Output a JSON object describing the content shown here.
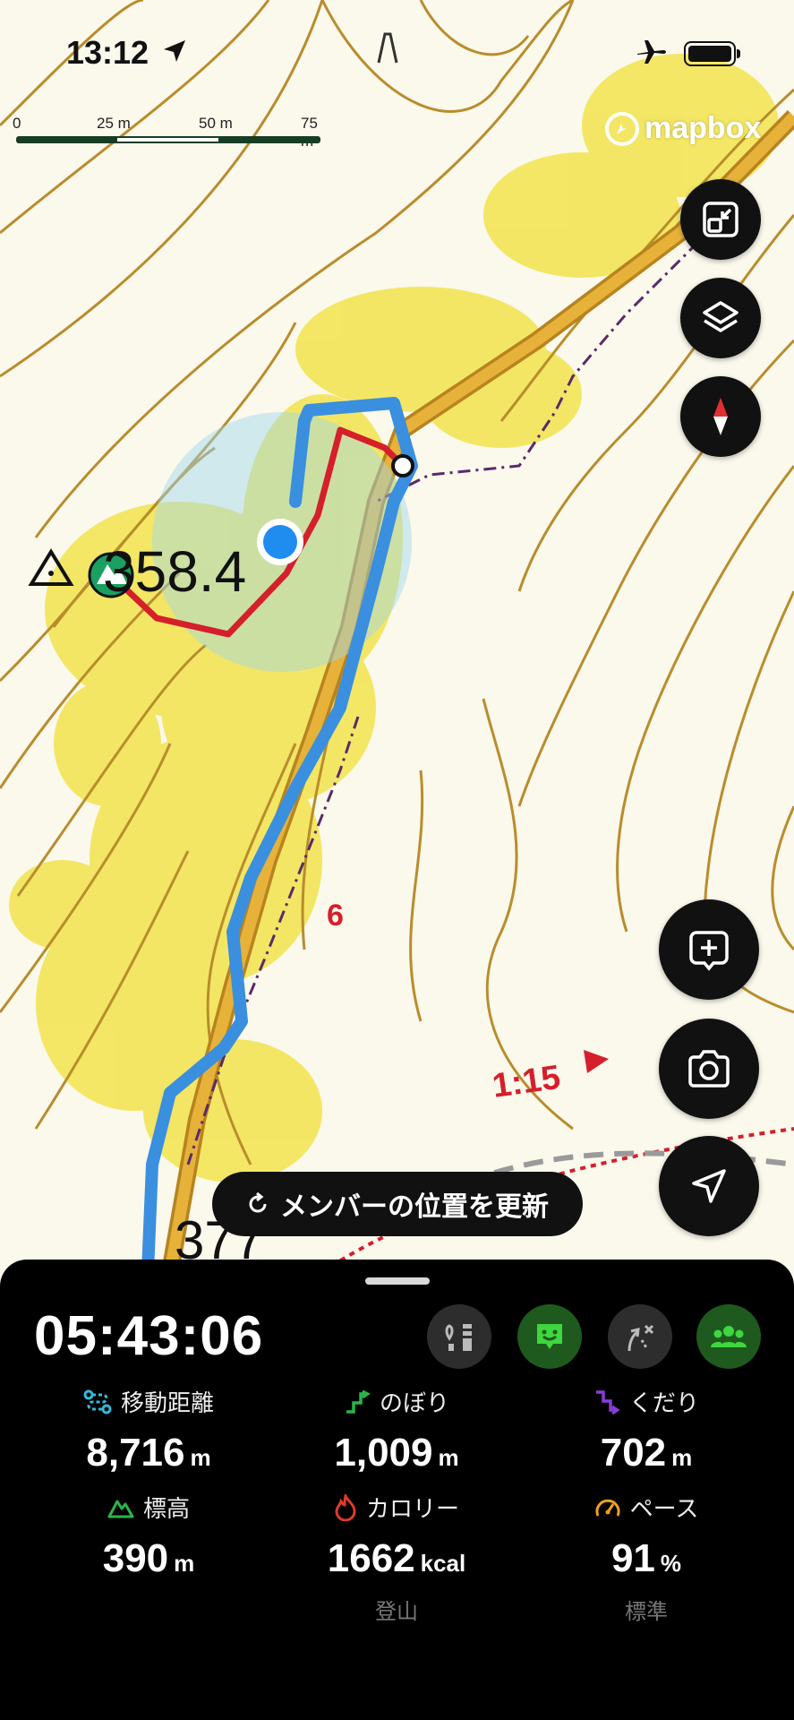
{
  "status_bar": {
    "time": "13:12"
  },
  "map": {
    "scale_labels": [
      "0",
      "25 m",
      "50 m",
      "75 m"
    ],
    "attribution": "mapbox",
    "elevation_label": "358.4",
    "contour_label_bottom": "377",
    "section_number": "6",
    "course_time": "1:15"
  },
  "update_members_button": {
    "label": "メンバーの位置を更新"
  },
  "stats_panel": {
    "elapsed_time": "05:43:06",
    "stats": [
      {
        "label": "移動距離",
        "value": "8,716",
        "unit": "m",
        "icon": "route-icon"
      },
      {
        "label": "のぼり",
        "value": "1,009",
        "unit": "m",
        "icon": "ascent-icon"
      },
      {
        "label": "くだり",
        "value": "702",
        "unit": "m",
        "icon": "descent-icon"
      },
      {
        "label": "標高",
        "value": "390",
        "unit": "m",
        "icon": "mountain-icon"
      },
      {
        "label": "カロリー",
        "value": "1662",
        "unit": "kcal",
        "sub": "登山",
        "icon": "flame-icon"
      },
      {
        "label": "ペース",
        "value": "91",
        "unit": "%",
        "sub": "標準",
        "icon": "speedometer-icon"
      }
    ]
  },
  "colors": {
    "route_blue": "#3a8fdf",
    "track_red": "#d51f2a",
    "trail_orange": "#dca52a",
    "green_accent": "#2fbf3c",
    "ascent_green": "#29b64a",
    "descent_purple": "#8a3bd8",
    "route_icon_teal": "#35b8d8",
    "flame_red": "#e03a2a",
    "pace_orange": "#f0a020"
  }
}
